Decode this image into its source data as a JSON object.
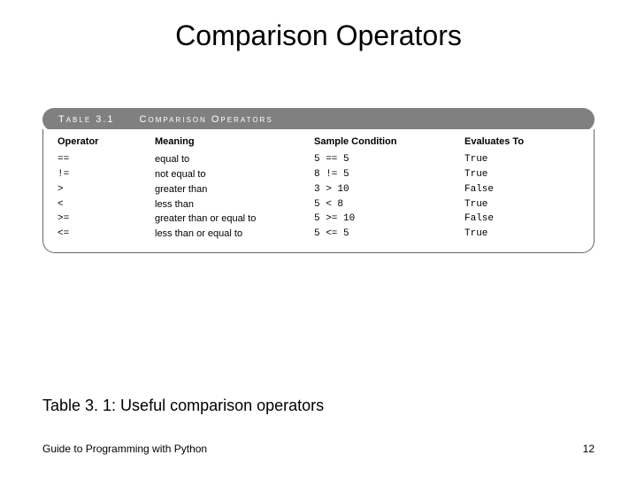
{
  "title": "Comparison Operators",
  "table": {
    "label": "Table 3.1",
    "name": "Comparison Operators",
    "headers": {
      "operator": "Operator",
      "meaning": "Meaning",
      "sample": "Sample Condition",
      "evaluates": "Evaluates To"
    },
    "rows": [
      {
        "operator": "==",
        "meaning": "equal to",
        "sample": "5 == 5",
        "evaluates": "True"
      },
      {
        "operator": "!=",
        "meaning": "not equal to",
        "sample": "8 != 5",
        "evaluates": "True"
      },
      {
        "operator": ">",
        "meaning": "greater than",
        "sample": "3 > 10",
        "evaluates": "False"
      },
      {
        "operator": "<",
        "meaning": "less than",
        "sample": "5 < 8",
        "evaluates": "True"
      },
      {
        "operator": ">=",
        "meaning": "greater than or equal to",
        "sample": "5 >= 10",
        "evaluates": "False"
      },
      {
        "operator": "<=",
        "meaning": "less than or equal to",
        "sample": "5 <= 5",
        "evaluates": "True"
      }
    ]
  },
  "caption": "Table 3. 1: Useful comparison operators",
  "footer": {
    "left": "Guide to Programming with Python",
    "right": "12"
  },
  "chart_data": {
    "type": "table",
    "title": "Table 3.1 Comparison Operators",
    "columns": [
      "Operator",
      "Meaning",
      "Sample Condition",
      "Evaluates To"
    ],
    "rows": [
      [
        "==",
        "equal to",
        "5 == 5",
        "True"
      ],
      [
        "!=",
        "not equal to",
        "8 != 5",
        "True"
      ],
      [
        ">",
        "greater than",
        "3 > 10",
        "False"
      ],
      [
        "<",
        "less than",
        "5 < 8",
        "True"
      ],
      [
        ">=",
        "greater than or equal to",
        "5 >= 10",
        "False"
      ],
      [
        "<=",
        "less than or equal to",
        "5 <= 5",
        "True"
      ]
    ]
  }
}
